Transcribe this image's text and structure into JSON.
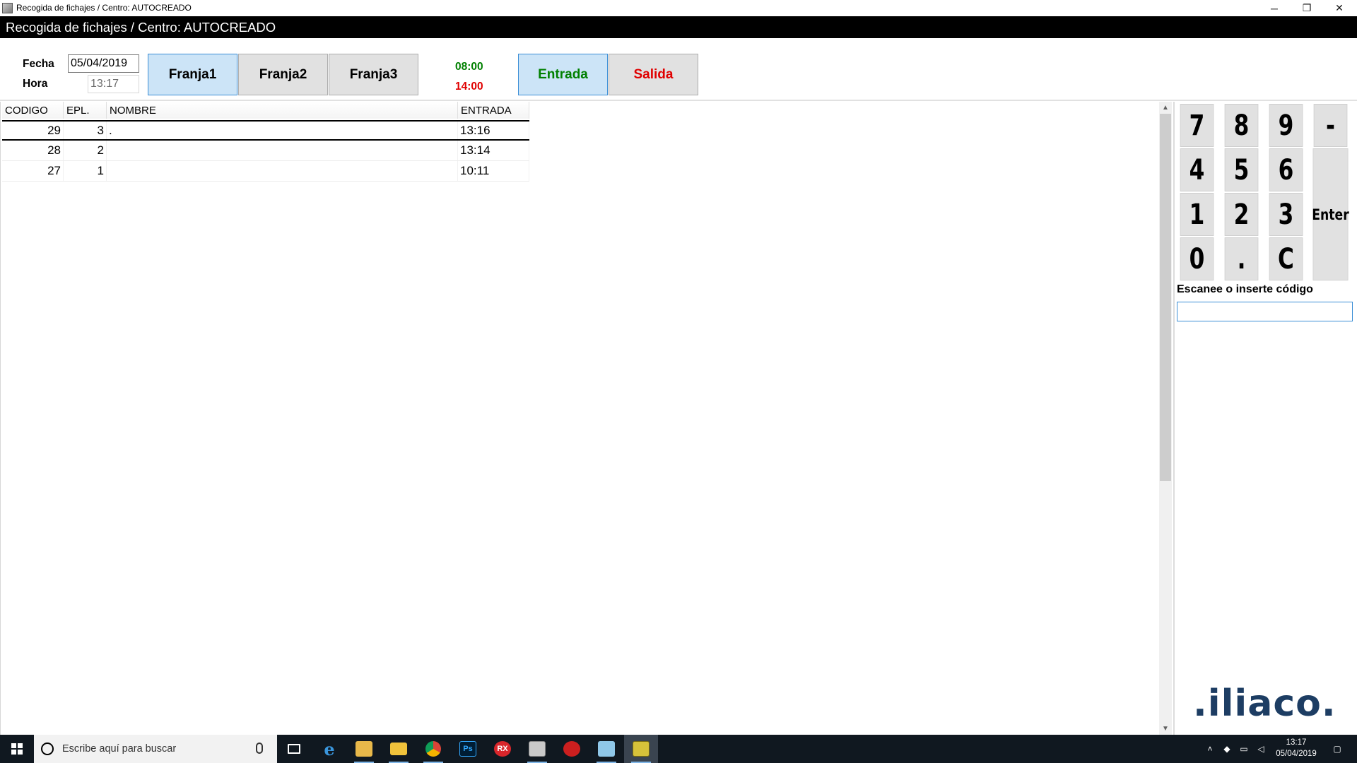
{
  "window": {
    "title": "Recogida de fichajes / Centro: AUTOCREADO",
    "minimize_glyph": "─",
    "restore_glyph": "❐",
    "close_glyph": "✕"
  },
  "header": {
    "title": "Recogida de fichajes / Centro: AUTOCREADO"
  },
  "controls": {
    "fecha_label": "Fecha",
    "fecha_value": "05/04/2019",
    "hora_label": "Hora",
    "hora_value": "13:17",
    "franjas": [
      "Franja1",
      "Franja2",
      "Franja3"
    ],
    "active_franja": "Franja1",
    "start_time": "08:00",
    "end_time": "14:00",
    "entrada_label": "Entrada",
    "salida_label": "Salida"
  },
  "colors": {
    "entrada_green": "#008000",
    "salida_red": "#e00000",
    "active_button_bg": "#cce4f7",
    "header_bg": "#000000"
  },
  "table": {
    "columns": [
      "CODIGO",
      "EPL.",
      "NOMBRE",
      "ENTRADA"
    ],
    "rows": [
      {
        "codigo": "29",
        "epl": "3",
        "nombre": ".",
        "entrada": "13:16"
      },
      {
        "codigo": "28",
        "epl": "2",
        "nombre": "",
        "entrada": "13:14"
      },
      {
        "codigo": "27",
        "epl": "1",
        "nombre": "",
        "entrada": "10:11"
      }
    ]
  },
  "keypad": {
    "keys": [
      "7",
      "8",
      "9",
      "-",
      "4",
      "5",
      "6",
      "1",
      "2",
      "3",
      "0",
      ".",
      "C"
    ],
    "enter_label": "Enter"
  },
  "scan": {
    "label": "Escanee o inserte código",
    "value": ""
  },
  "logo": {
    "text": ".iliaco."
  },
  "taskbar": {
    "search_placeholder": "Escribe aquí para buscar",
    "icons": [
      "task-view-icon",
      "edge-icon",
      "mail-app-icon",
      "file-explorer-icon",
      "chrome-icon",
      "photoshop-icon",
      "rx-app-icon",
      "fichajes-app-icon",
      "flash-app-icon",
      "notes-app-icon",
      "iliaco-app-icon"
    ],
    "rx_label": "RX",
    "ps_label": "Ps",
    "clock_time": "13:17",
    "clock_date": "05/04/2019"
  }
}
